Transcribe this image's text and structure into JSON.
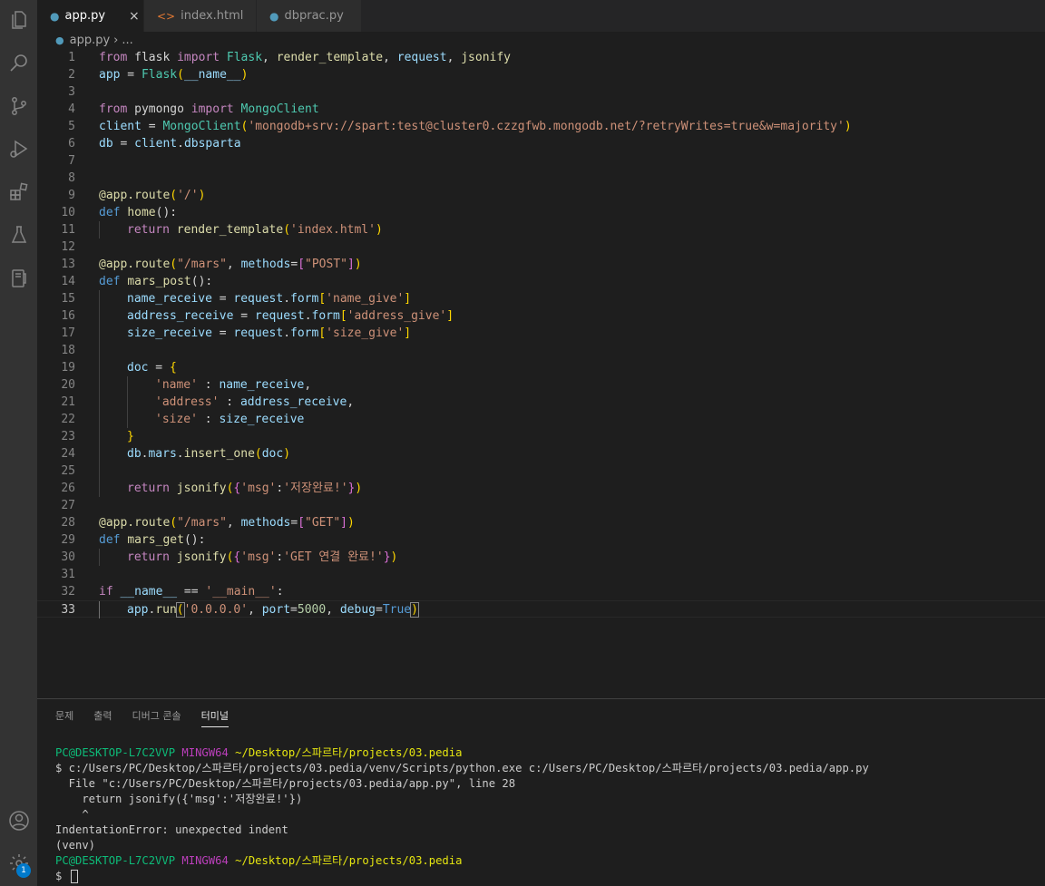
{
  "tabs": [
    {
      "label": "app.py",
      "icon": "python-icon",
      "icon_color": "#519aba",
      "active": true
    },
    {
      "label": "index.html",
      "icon": "html-icon",
      "icon_color": "#e37933"
    },
    {
      "label": "dbprac.py",
      "icon": "python-icon",
      "icon_color": "#519aba"
    }
  ],
  "breadcrumb": {
    "file": "app.py",
    "rest": "..."
  },
  "editor": {
    "current_line": 33,
    "line_numbers": [
      "1",
      "2",
      "3",
      "4",
      "5",
      "6",
      "7",
      "8",
      "9",
      "10",
      "11",
      "12",
      "13",
      "14",
      "15",
      "16",
      "17",
      "18",
      "19",
      "20",
      "21",
      "22",
      "23",
      "24",
      "25",
      "26",
      "27",
      "28",
      "29",
      "30",
      "31",
      "32",
      "33"
    ],
    "tokens": {
      "l1": [
        "from",
        " flask ",
        "import",
        " Flask",
        ", ",
        "render_template",
        ", ",
        "request",
        ", ",
        "jsonify"
      ],
      "l2": [
        "app",
        " = ",
        "Flask",
        "(",
        "__name__",
        ")"
      ],
      "l4": [
        "from",
        " pymongo ",
        "import",
        " MongoClient"
      ],
      "l5": [
        "client",
        " = ",
        "MongoClient",
        "(",
        "'mongodb+srv://spart:test@cluster0.czzgfwb.mongodb.net/?retryWrites=true&w=majority'",
        ")"
      ],
      "l6": [
        "db",
        " = ",
        "client",
        ".",
        "dbsparta"
      ],
      "l9": [
        "@app.route",
        "(",
        "'/'",
        ")"
      ],
      "l10": [
        "def",
        " ",
        "home",
        "():"
      ],
      "l11": [
        "return",
        " ",
        "render_template",
        "(",
        "'index.html'",
        ")"
      ],
      "l13": [
        "@app.route",
        "(",
        "\"/mars\"",
        ", ",
        "methods",
        "=",
        "[",
        "\"POST\"",
        "]",
        ")"
      ],
      "l14": [
        "def",
        " ",
        "mars_post",
        "():"
      ],
      "l15": [
        "name_receive",
        " = ",
        "request",
        ".",
        "form",
        "[",
        "'name_give'",
        "]"
      ],
      "l16": [
        "address_receive",
        " = ",
        "request",
        ".",
        "form",
        "[",
        "'address_give'",
        "]"
      ],
      "l17": [
        "size_receive",
        " = ",
        "request",
        ".",
        "form",
        "[",
        "'size_give'",
        "]"
      ],
      "l19": [
        "doc",
        " = ",
        "{"
      ],
      "l20": [
        "'name'",
        " : ",
        "name_receive",
        ","
      ],
      "l21": [
        "'address'",
        " : ",
        "address_receive",
        ","
      ],
      "l22": [
        "'size'",
        " : ",
        "size_receive"
      ],
      "l23": [
        "}"
      ],
      "l24": [
        "db",
        ".",
        "mars",
        ".",
        "insert_one",
        "(",
        "doc",
        ")"
      ],
      "l26": [
        "return",
        " ",
        "jsonify",
        "(",
        "{",
        "'msg'",
        ":",
        "'저장완료!'",
        "}",
        ")"
      ],
      "l28": [
        "@app.route",
        "(",
        "\"/mars\"",
        ", ",
        "methods",
        "=",
        "[",
        "\"GET\"",
        "]",
        ")"
      ],
      "l29": [
        "def",
        " ",
        "mars_get",
        "():"
      ],
      "l30": [
        "return",
        " ",
        "jsonify",
        "(",
        "{",
        "'msg'",
        ":",
        "'GET 연결 완료!'",
        "}",
        ")"
      ],
      "l32": [
        "if",
        " ",
        "__name__",
        " == ",
        "'__main__'",
        ":"
      ],
      "l33": [
        "app",
        ".",
        "run",
        "(",
        "'0.0.0.0'",
        ", ",
        "port",
        "=",
        "5000",
        ", ",
        "debug",
        "=",
        "True",
        ")"
      ]
    }
  },
  "panel": {
    "tabs": [
      "문제",
      "출력",
      "디버그 콘솔",
      "터미널"
    ],
    "active_tab": "터미널",
    "terminal": {
      "prompt1": {
        "user": "PC@DESKTOP-L7C2VVP",
        "shell": "MINGW64",
        "path": "~/Desktop/스파르타/projects/03.pedia"
      },
      "command": "$ c:/Users/PC/Desktop/스파르타/projects/03.pedia/venv/Scripts/python.exe c:/Users/PC/Desktop/스파르타/projects/03.pedia/app.py",
      "file_line": "  File \"c:/Users/PC/Desktop/스파르타/projects/03.pedia/app.py\", line 28",
      "code_line": "    return jsonify({'msg':'저장완료!'})",
      "caret_line": "    ^",
      "error": "IndentationError: unexpected indent",
      "venv": "(venv)",
      "prompt2": {
        "user": "PC@DESKTOP-L7C2VVP",
        "shell": "MINGW64",
        "path": "~/Desktop/스파르타/projects/03.pedia"
      },
      "dollar": "$"
    }
  },
  "activity_bar": {
    "icons": [
      "files-icon",
      "search-icon",
      "source-control-icon",
      "run-debug-icon",
      "extensions-icon",
      "testing-icon",
      "remote-explorer-icon",
      "account-icon",
      "settings-gear-icon"
    ],
    "settings_badge": "1"
  }
}
